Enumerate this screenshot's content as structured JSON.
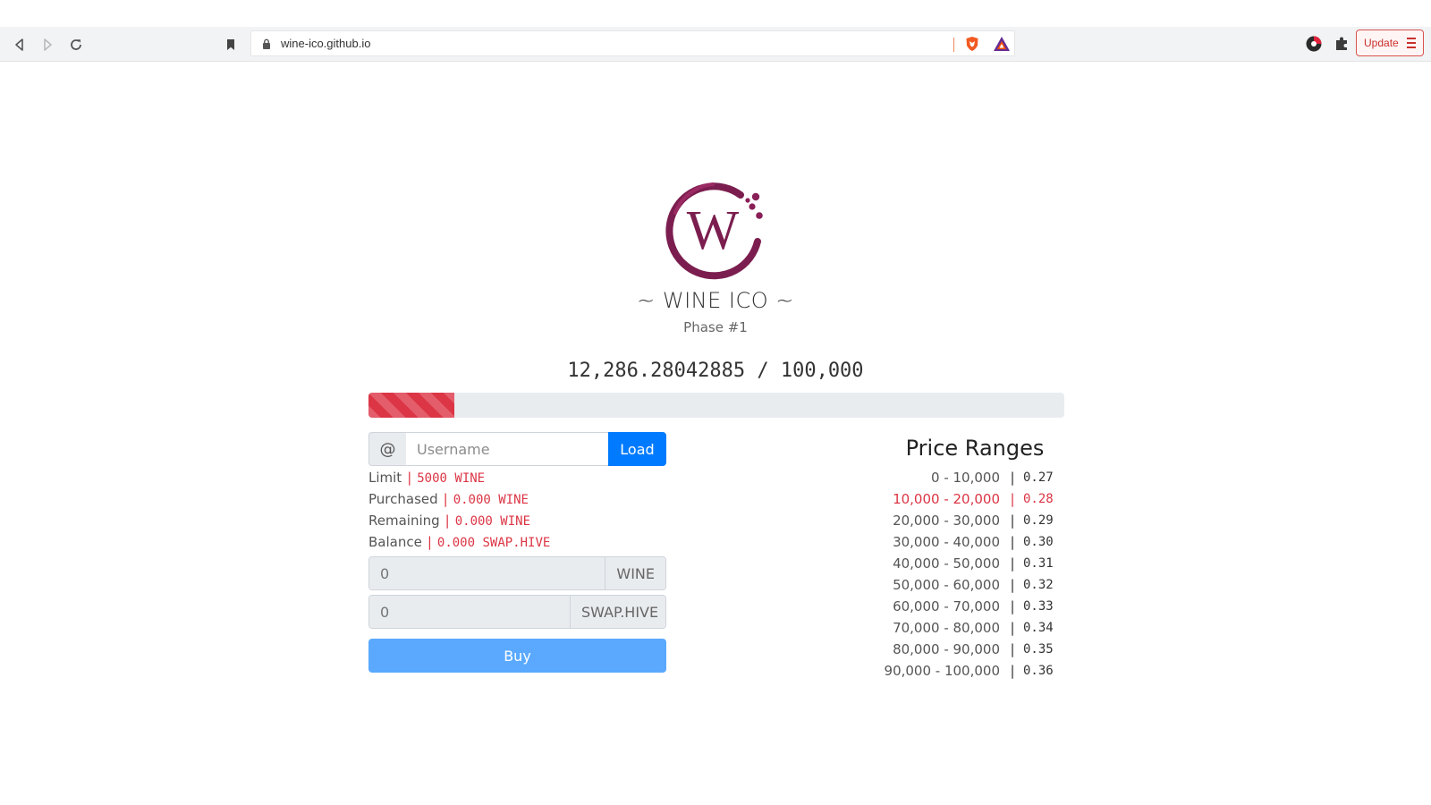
{
  "browser": {
    "url": "wine-ico.github.io",
    "update_label": "Update"
  },
  "header": {
    "title": "~ WINE ICO ~",
    "phase": "Phase #1",
    "logo_letter": "W"
  },
  "progress": {
    "text": "12,286.28042885 / 100,000",
    "sold": 12286.28042885,
    "total": 100000,
    "fraction": 0.1229
  },
  "account": {
    "prefix": "@",
    "username_placeholder": "Username",
    "username_value": "",
    "load_label": "Load"
  },
  "info": {
    "limit_label": "Limit",
    "limit_value": "5000 WINE",
    "purchased_label": "Purchased",
    "purchased_value": "0.000 WINE",
    "remaining_label": "Remaining",
    "remaining_value": "0.000 WINE",
    "balance_label": "Balance",
    "balance_value": "0.000 SWAP.HIVE"
  },
  "purchase": {
    "wine_placeholder": "0",
    "wine_suffix": "WINE",
    "hive_placeholder": "0",
    "hive_suffix": "SWAP.HIVE",
    "buy_label": "Buy"
  },
  "price_ranges": {
    "title": "Price Ranges",
    "active_index": 1,
    "rows": [
      {
        "range": "0 - 10,000",
        "price": "0.27"
      },
      {
        "range": "10,000 - 20,000",
        "price": "0.28"
      },
      {
        "range": "20,000 - 30,000",
        "price": "0.29"
      },
      {
        "range": "30,000 - 40,000",
        "price": "0.30"
      },
      {
        "range": "40,000 - 50,000",
        "price": "0.31"
      },
      {
        "range": "50,000 - 60,000",
        "price": "0.32"
      },
      {
        "range": "60,000 - 70,000",
        "price": "0.33"
      },
      {
        "range": "70,000 - 80,000",
        "price": "0.34"
      },
      {
        "range": "80,000 - 90,000",
        "price": "0.35"
      },
      {
        "range": "90,000 - 100,000",
        "price": "0.36"
      }
    ]
  },
  "colors": {
    "accent_red": "#dc3545",
    "primary_blue": "#007bff",
    "buy_blue": "#5aa9ff",
    "wine": "#7b1e4f"
  },
  "icons": {
    "back": "back-arrow-icon",
    "forward": "forward-arrow-icon",
    "reload": "reload-icon",
    "bookmark": "bookmark-icon",
    "lock": "lock-icon",
    "brave": "brave-shield-icon",
    "rewards": "brave-rewards-icon",
    "extension1": "extension-icon",
    "puzzle": "puzzle-icon",
    "menu": "menu-icon"
  }
}
